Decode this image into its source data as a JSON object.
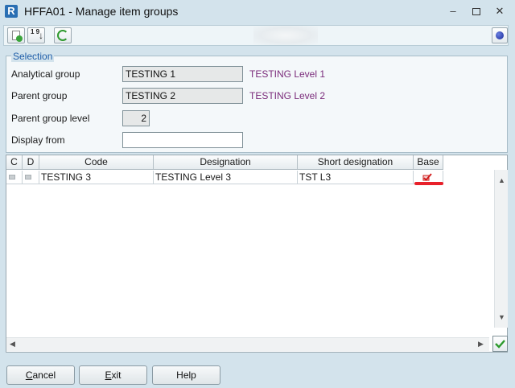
{
  "window": {
    "app_letter": "R",
    "title": "HFFA01 - Manage item groups",
    "minimize": "–",
    "close": "✕"
  },
  "toolbar": {
    "sort_label": "1 9"
  },
  "selection": {
    "legend": "Selection",
    "fields": [
      {
        "label": "Analytical group",
        "value": "TESTING 1",
        "description": "TESTING Level 1"
      },
      {
        "label": "Parent group",
        "value": "TESTING 2",
        "description": "TESTING Level 2"
      },
      {
        "label": "Parent group level",
        "value": "2"
      },
      {
        "label": "Display from",
        "value": ""
      }
    ]
  },
  "grid": {
    "columns": [
      "C",
      "D",
      "Code",
      "Designation",
      "Short designation",
      "Base"
    ],
    "rows": [
      {
        "code": "TESTING 3",
        "designation": "TESTING Level 3",
        "short_designation": "TST L3",
        "base_checked": true
      }
    ]
  },
  "buttons": {
    "cancel_first": "C",
    "cancel_rest": "ancel",
    "exit_first": "E",
    "exit_rest": "xit",
    "help": "Help"
  },
  "colors": {
    "accent": "#1f5ea8",
    "description": "#7a2a7a",
    "annotation": "#e8202a",
    "check": "#d01818"
  }
}
